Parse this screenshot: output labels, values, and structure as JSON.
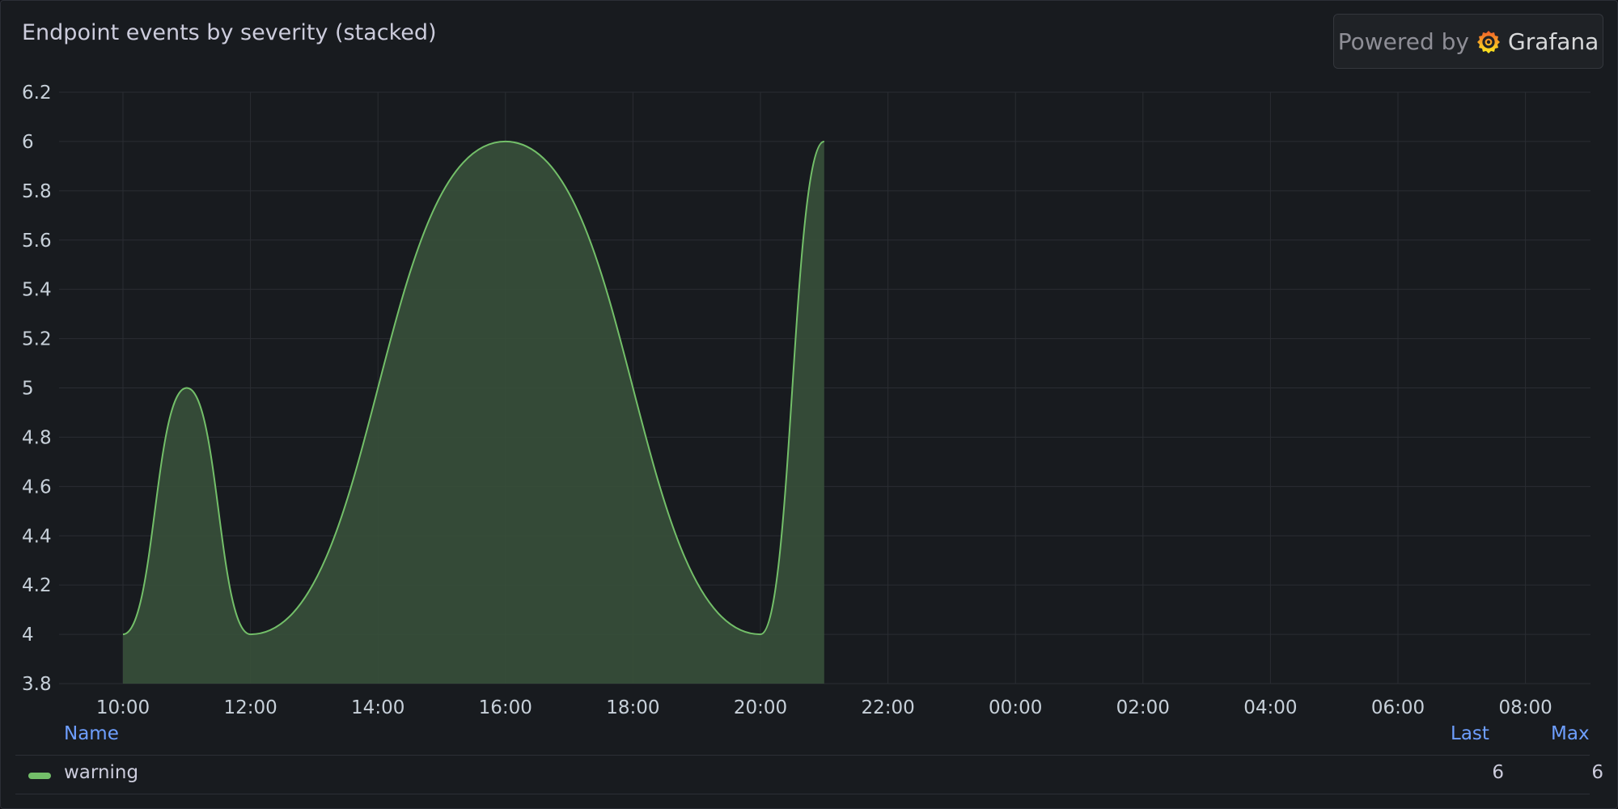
{
  "panel": {
    "title": "Endpoint events by severity (stacked)",
    "powered_by": "Powered by",
    "brand": "Grafana"
  },
  "legend": {
    "headers": {
      "name": "Name",
      "last": "Last",
      "max": "Max"
    },
    "rows": [
      {
        "name": "warning",
        "color": "#73bf69",
        "last": "6",
        "max": "6"
      }
    ]
  },
  "chart_data": {
    "type": "area",
    "title": "Endpoint events by severity (stacked)",
    "xlabel": "",
    "ylabel": "",
    "ylim": [
      3.8,
      6.2
    ],
    "yticks": [
      "3.8",
      "4",
      "4.2",
      "4.4",
      "4.6",
      "4.8",
      "5",
      "5.2",
      "5.4",
      "5.6",
      "5.8",
      "6",
      "6.2"
    ],
    "xticks": [
      "10:00",
      "12:00",
      "14:00",
      "16:00",
      "18:00",
      "20:00",
      "22:00",
      "00:00",
      "02:00",
      "04:00",
      "06:00",
      "08:00"
    ],
    "x_range": [
      "10:00",
      "09:00"
    ],
    "grid": true,
    "legend_position": "bottom",
    "series": [
      {
        "name": "warning",
        "color": "#73bf69",
        "fill": "#37503a",
        "x": [
          "10:00",
          "11:00",
          "12:00",
          "16:00",
          "20:00",
          "21:00"
        ],
        "y": [
          4,
          5,
          4,
          6,
          4,
          6
        ]
      }
    ]
  }
}
